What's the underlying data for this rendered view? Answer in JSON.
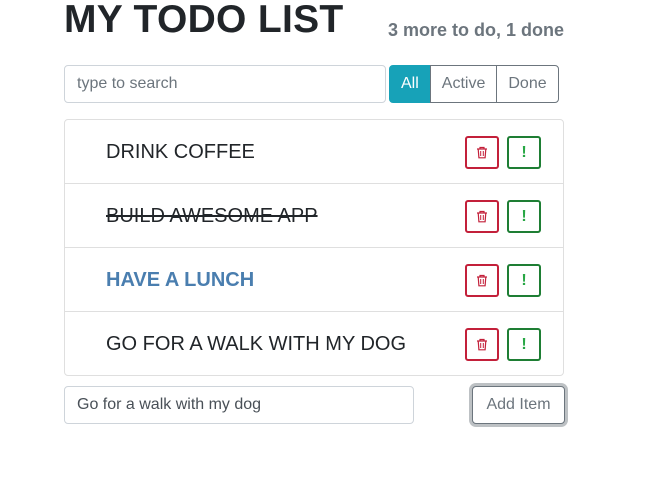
{
  "header": {
    "title": "MY TODO LIST",
    "status": "3 more to do, 1 done"
  },
  "search": {
    "placeholder": "type to search",
    "value": ""
  },
  "filters": [
    {
      "label": "All",
      "active": true
    },
    {
      "label": "Active",
      "active": false
    },
    {
      "label": "Done",
      "active": false
    }
  ],
  "todos": [
    {
      "label": "DRINK COFFEE",
      "done": false,
      "important": false
    },
    {
      "label": "BUILD AWESOME APP",
      "done": true,
      "important": false
    },
    {
      "label": "HAVE A LUNCH",
      "done": false,
      "important": true
    },
    {
      "label": "GO FOR A WALK WITH MY DOG",
      "done": false,
      "important": false
    }
  ],
  "item_buttons": {
    "delete_icon": "trash-icon",
    "important_label": "!"
  },
  "add_form": {
    "value": "Go for a walk with my dog",
    "button_label": "Add Item"
  },
  "colors": {
    "filter_active": "#17a2b8",
    "delete": "#c3203a",
    "important_button": "#28a745",
    "important_text": "#4a7eaf"
  }
}
